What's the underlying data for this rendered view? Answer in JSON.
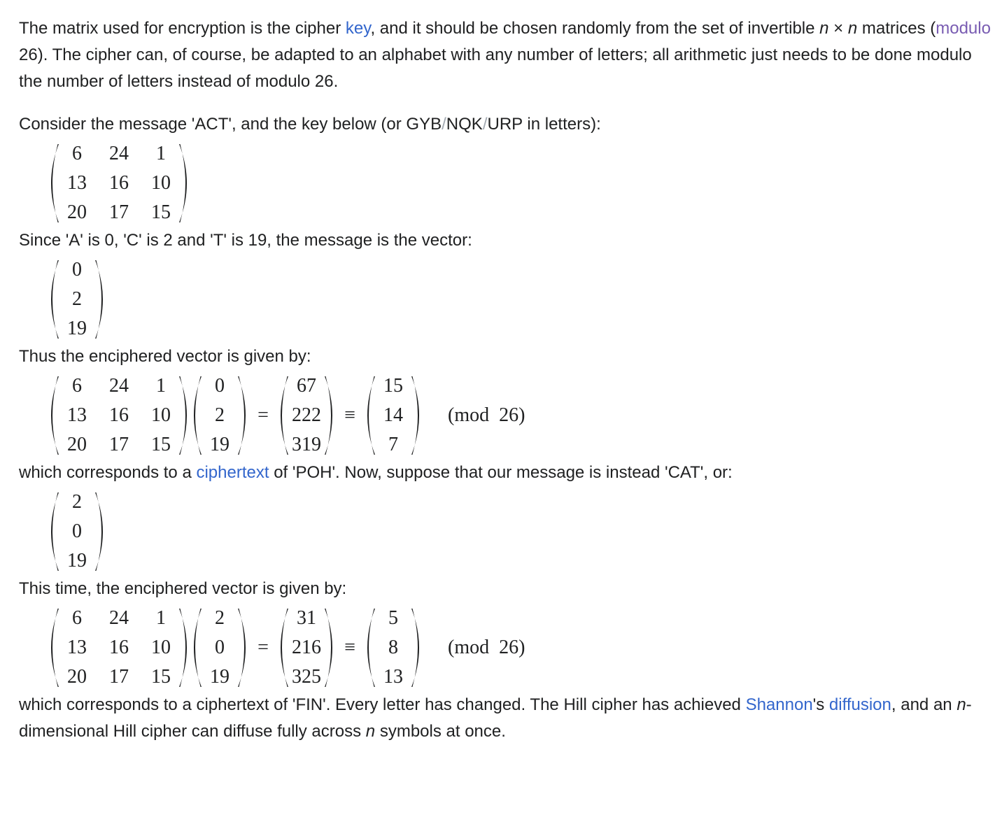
{
  "colors": {
    "text": "#202122",
    "link": "#3366cc",
    "visited_link": "#795cb2",
    "separator": "#a2a9b1"
  },
  "para1": {
    "t1": "The matrix used for encryption is the cipher ",
    "link_key": "key",
    "t2": ", and it should be chosen randomly from the set of invertible ",
    "n1": "n",
    "times": " × ",
    "n2": "n",
    "t3": " matrices (",
    "link_modulo": "modulo",
    "t4": " 26). The cipher can, of course, be adapted to an alphabet with any number of letters; all arithmetic just needs to be done modulo the number of letters instead of modulo 26."
  },
  "para2": {
    "t1": "Consider the message 'ACT', and the key below (or GYB",
    "s1": "/",
    "t2": "NQK",
    "s2": "/",
    "t3": "URP in letters):"
  },
  "key_matrix": [
    [
      6,
      24,
      1
    ],
    [
      13,
      16,
      10
    ],
    [
      20,
      17,
      15
    ]
  ],
  "para3": "Since 'A' is 0, 'C' is 2 and 'T' is 19, the message is the vector:",
  "vector_act": [
    [
      0
    ],
    [
      2
    ],
    [
      19
    ]
  ],
  "para4": "Thus the enciphered vector is given by:",
  "equation1": {
    "vector": [
      [
        0
      ],
      [
        2
      ],
      [
        19
      ]
    ],
    "product": [
      [
        67
      ],
      [
        222
      ],
      [
        319
      ]
    ],
    "reduced": [
      [
        15
      ],
      [
        14
      ],
      [
        7
      ]
    ],
    "eq": "=",
    "equiv": "≡",
    "mod": "(mod  26)"
  },
  "para5": {
    "t1": "which corresponds to a ",
    "link_ciphertext": "ciphertext",
    "t2": " of 'POH'. Now, suppose that our message is instead 'CAT', or:"
  },
  "vector_cat": [
    [
      2
    ],
    [
      0
    ],
    [
      19
    ]
  ],
  "para6": "This time, the enciphered vector is given by:",
  "equation2": {
    "vector": [
      [
        2
      ],
      [
        0
      ],
      [
        19
      ]
    ],
    "product": [
      [
        31
      ],
      [
        216
      ],
      [
        325
      ]
    ],
    "reduced": [
      [
        5
      ],
      [
        8
      ],
      [
        13
      ]
    ],
    "eq": "=",
    "equiv": "≡",
    "mod": "(mod  26)"
  },
  "para7": {
    "t1": "which corresponds to a ciphertext of 'FIN'. Every letter has changed. The Hill cipher has achieved ",
    "link_shannon": "Shannon",
    "t2": "'s ",
    "link_diffusion": "diffusion",
    "t3": ", and an ",
    "n1": "n",
    "t4": "-dimensional Hill cipher can diffuse fully across ",
    "n2": "n",
    "t5": " symbols at once."
  }
}
